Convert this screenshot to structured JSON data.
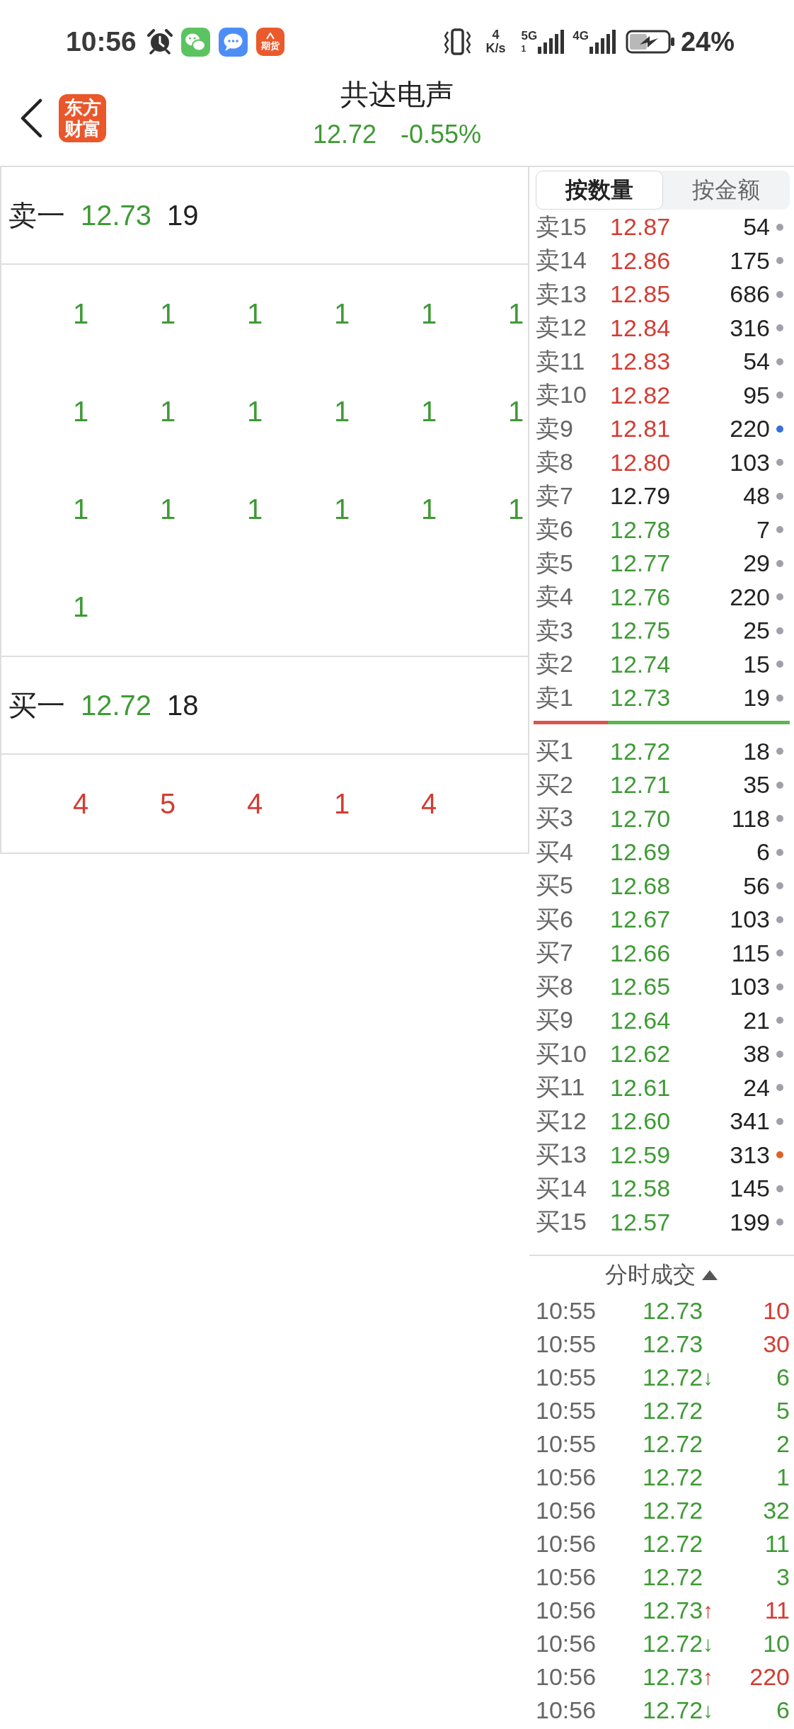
{
  "status_bar": {
    "time": "10:56",
    "app_badge_text": "期货",
    "net_speed_value": "4",
    "net_speed_unit": "K/s",
    "sim1_network": "5G",
    "sim1_slot": "1",
    "sim2_network": "4G",
    "battery": "24%"
  },
  "header": {
    "logo_text": "东方财富",
    "title": "共达电声",
    "price": "12.72",
    "change": "-0.55%",
    "falling": true
  },
  "queue_panel": {
    "levels": [
      {
        "buy": false,
        "label": "卖一",
        "price": "12.73",
        "volume": "19",
        "falling": true,
        "queue": [
          "1",
          "1",
          "1",
          "1",
          "1",
          "1",
          "1",
          "1",
          "1",
          "1",
          "1",
          "1",
          "1",
          "1",
          "1",
          "1",
          "1",
          "1",
          "1"
        ]
      },
      {
        "buy": true,
        "label": "买一",
        "price": "12.72",
        "volume": "18",
        "falling": true,
        "queue": [
          "4",
          "5",
          "4",
          "1",
          "4"
        ]
      }
    ]
  },
  "order_book": {
    "tabs": [
      {
        "label": "按数量",
        "selected": true
      },
      {
        "label": "按金额",
        "selected": false
      }
    ],
    "asks": [
      {
        "kind": "up",
        "label": "卖15",
        "price": "12.87",
        "volume": "54",
        "color": "#a0a0a8"
      },
      {
        "kind": "up",
        "label": "卖14",
        "price": "12.86",
        "volume": "175",
        "color": "#a0a0a8"
      },
      {
        "kind": "up",
        "label": "卖13",
        "price": "12.85",
        "volume": "686",
        "color": "#a0a0a8"
      },
      {
        "kind": "up",
        "label": "卖12",
        "price": "12.84",
        "volume": "316",
        "color": "#a0a0a8"
      },
      {
        "kind": "up",
        "label": "卖11",
        "price": "12.83",
        "volume": "54",
        "color": "#a0a0a8"
      },
      {
        "kind": "up",
        "label": "卖10",
        "price": "12.82",
        "volume": "95",
        "color": "#a0a0a8"
      },
      {
        "kind": "up",
        "label": "卖9",
        "price": "12.81",
        "volume": "220",
        "color": "#3b6fd8"
      },
      {
        "kind": "up",
        "label": "卖8",
        "price": "12.80",
        "volume": "103",
        "color": "#a0a0a8"
      },
      {
        "kind": "flat",
        "label": "卖7",
        "price": "12.79",
        "volume": "48",
        "color": "#a0a0a8"
      },
      {
        "kind": "down",
        "label": "卖6",
        "price": "12.78",
        "volume": "7",
        "color": "#a0a0a8"
      },
      {
        "kind": "down",
        "label": "卖5",
        "price": "12.77",
        "volume": "29",
        "color": "#a0a0a8"
      },
      {
        "kind": "down",
        "label": "卖4",
        "price": "12.76",
        "volume": "220",
        "color": "#a0a0a8"
      },
      {
        "kind": "down",
        "label": "卖3",
        "price": "12.75",
        "volume": "25",
        "color": "#a0a0a8"
      },
      {
        "kind": "down",
        "label": "卖2",
        "price": "12.74",
        "volume": "15",
        "color": "#a0a0a8"
      },
      {
        "kind": "down",
        "label": "卖1",
        "price": "12.73",
        "volume": "19",
        "color": "#a0a0a8"
      }
    ],
    "ratio_bar": {
      "level": 0.29
    },
    "bids": [
      {
        "kind": "down",
        "label": "买1",
        "price": "12.72",
        "volume": "18",
        "color": "#a0a0a8"
      },
      {
        "kind": "down",
        "label": "买2",
        "price": "12.71",
        "volume": "35",
        "color": "#a0a0a8"
      },
      {
        "kind": "down",
        "label": "买3",
        "price": "12.70",
        "volume": "118",
        "color": "#a0a0a8"
      },
      {
        "kind": "down",
        "label": "买4",
        "price": "12.69",
        "volume": "6",
        "color": "#a0a0a8"
      },
      {
        "kind": "down",
        "label": "买5",
        "price": "12.68",
        "volume": "56",
        "color": "#a0a0a8"
      },
      {
        "kind": "down",
        "label": "买6",
        "price": "12.67",
        "volume": "103",
        "color": "#a0a0a8"
      },
      {
        "kind": "down",
        "label": "买7",
        "price": "12.66",
        "volume": "115",
        "color": "#a0a0a8"
      },
      {
        "kind": "down",
        "label": "买8",
        "price": "12.65",
        "volume": "103",
        "color": "#a0a0a8"
      },
      {
        "kind": "down",
        "label": "买9",
        "price": "12.64",
        "volume": "21",
        "color": "#a0a0a8"
      },
      {
        "kind": "down",
        "label": "买10",
        "price": "12.62",
        "volume": "38",
        "color": "#a0a0a8"
      },
      {
        "kind": "down",
        "label": "买11",
        "price": "12.61",
        "volume": "24",
        "color": "#a0a0a8"
      },
      {
        "kind": "down",
        "label": "买12",
        "price": "12.60",
        "volume": "341",
        "color": "#a0a0a8"
      },
      {
        "kind": "down",
        "label": "买13",
        "price": "12.59",
        "volume": "313",
        "color": "#e0602a"
      },
      {
        "kind": "down",
        "label": "买14",
        "price": "12.58",
        "volume": "145",
        "color": "#a0a0a8"
      },
      {
        "kind": "down",
        "label": "买15",
        "price": "12.57",
        "volume": "199",
        "color": "#a0a0a8"
      }
    ]
  },
  "trades": {
    "title": "分时成交",
    "rows": [
      {
        "time": "10:55",
        "price": "12.73",
        "falling": true,
        "volume": "10",
        "buy": true
      },
      {
        "time": "10:55",
        "price": "12.73",
        "falling": true,
        "volume": "30",
        "buy": true
      },
      {
        "time": "10:55",
        "price": "12.72",
        "falling": true,
        "arrow": "↓",
        "volume": "6",
        "buy": false
      },
      {
        "time": "10:55",
        "price": "12.72",
        "falling": true,
        "volume": "5",
        "buy": false
      },
      {
        "time": "10:55",
        "price": "12.72",
        "falling": true,
        "volume": "2",
        "buy": false
      },
      {
        "time": "10:56",
        "price": "12.72",
        "falling": true,
        "volume": "1",
        "buy": false
      },
      {
        "time": "10:56",
        "price": "12.72",
        "falling": true,
        "volume": "32",
        "buy": false
      },
      {
        "time": "10:56",
        "price": "12.72",
        "falling": true,
        "volume": "11",
        "buy": false
      },
      {
        "time": "10:56",
        "price": "12.72",
        "falling": true,
        "volume": "3",
        "buy": false
      },
      {
        "time": "10:56",
        "price": "12.73",
        "falling": true,
        "arrow": "↑",
        "volume": "11",
        "buy": true
      },
      {
        "time": "10:56",
        "price": "12.72",
        "falling": true,
        "arrow": "↓",
        "volume": "10",
        "buy": false
      },
      {
        "time": "10:56",
        "price": "12.73",
        "falling": true,
        "arrow": "↑",
        "volume": "220",
        "buy": true
      },
      {
        "time": "10:56",
        "price": "12.72",
        "falling": true,
        "arrow": "↓",
        "volume": "6",
        "buy": false
      }
    ]
  }
}
